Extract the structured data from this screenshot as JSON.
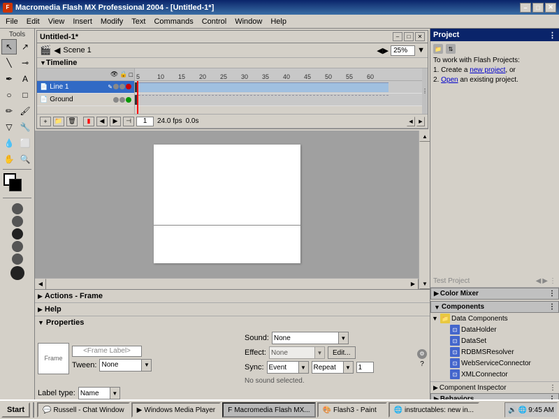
{
  "app": {
    "title": "Macromedia Flash MX Professional 2004 - [Untitled-1*]",
    "icon_label": "F"
  },
  "title_bar": {
    "title": "Macromedia Flash MX Professional 2004 - [Untitled-1*]",
    "minimize": "–",
    "maximize": "□",
    "close": "✕"
  },
  "menu": {
    "items": [
      "File",
      "Edit",
      "View",
      "Insert",
      "Modify",
      "Text",
      "Commands",
      "Control",
      "Window",
      "Help"
    ]
  },
  "tools": {
    "label": "Tools",
    "items": [
      "↖",
      "✎",
      "A",
      "✐",
      "□",
      "○",
      "⊘",
      "🖊",
      "🪣",
      "✏",
      "🔍",
      "🖐",
      "⟰",
      "◫"
    ]
  },
  "doc": {
    "title": "Untitled-1*",
    "scene": "Scene 1",
    "zoom": "25%"
  },
  "timeline": {
    "label": "Timeline",
    "layers": [
      {
        "name": "Line 1",
        "selected": true
      },
      {
        "name": "Ground",
        "selected": false
      }
    ],
    "frame_numbers": [
      "5",
      "10",
      "15",
      "20",
      "25",
      "30",
      "35",
      "40",
      "45",
      "50",
      "55",
      "60"
    ],
    "frame_rate": "24.0 fps",
    "current_time": "0.0s",
    "current_frame": "1"
  },
  "properties": {
    "label": "Properties",
    "frame_label": "<Frame Label>",
    "tween_label": "Tween:",
    "tween_value": "None",
    "sound_label": "Sound:",
    "sound_value": "None",
    "effect_label": "Effect:",
    "effect_value": "None",
    "edit_btn": "Edit...",
    "sync_label": "Sync:",
    "sync_value": "Event",
    "repeat_label": "Repeat",
    "repeat_value": "1",
    "no_sound": "No sound selected.",
    "label_type_label": "Label type:",
    "label_type_value": "Name"
  },
  "actions_panel": {
    "label": "Actions - Frame"
  },
  "help_panel": {
    "label": "Help"
  },
  "right_panel": {
    "title": "Project",
    "project_text": "To work with Flash Projects:",
    "step1_pre": "1. Create a ",
    "step1_link": "new project",
    "step1_post": ", or",
    "step2_pre": "2. ",
    "step2_link": "Open",
    "step2_post": " an existing project."
  },
  "color_mixer": {
    "label": "Color Mixer"
  },
  "components": {
    "label": "Components",
    "tree": [
      {
        "type": "folder",
        "name": "Data Components",
        "expanded": true,
        "indent": 0
      },
      {
        "type": "item",
        "name": "DataHolder",
        "indent": 1
      },
      {
        "type": "item",
        "name": "DataSet",
        "indent": 1
      },
      {
        "type": "item",
        "name": "RDBMSResolver",
        "indent": 1
      },
      {
        "type": "item",
        "name": "WebServiceConnector",
        "indent": 1
      },
      {
        "type": "item",
        "name": "XMLConnector",
        "indent": 1
      }
    ]
  },
  "component_inspector": {
    "label": "Component Inspector"
  },
  "behaviors": {
    "label": "Behaviors"
  },
  "test_project": {
    "label": "Test Project"
  },
  "taskbar": {
    "start": "Start",
    "items": [
      {
        "label": "Russell - Chat Window",
        "active": false
      },
      {
        "label": "Windows Media Player",
        "active": false
      },
      {
        "label": "Macromedia Flash MX...",
        "active": true
      },
      {
        "label": "Flash3 - Paint",
        "active": false
      },
      {
        "label": "instructables: new in...",
        "active": false
      }
    ],
    "time": "9:45 AM"
  }
}
